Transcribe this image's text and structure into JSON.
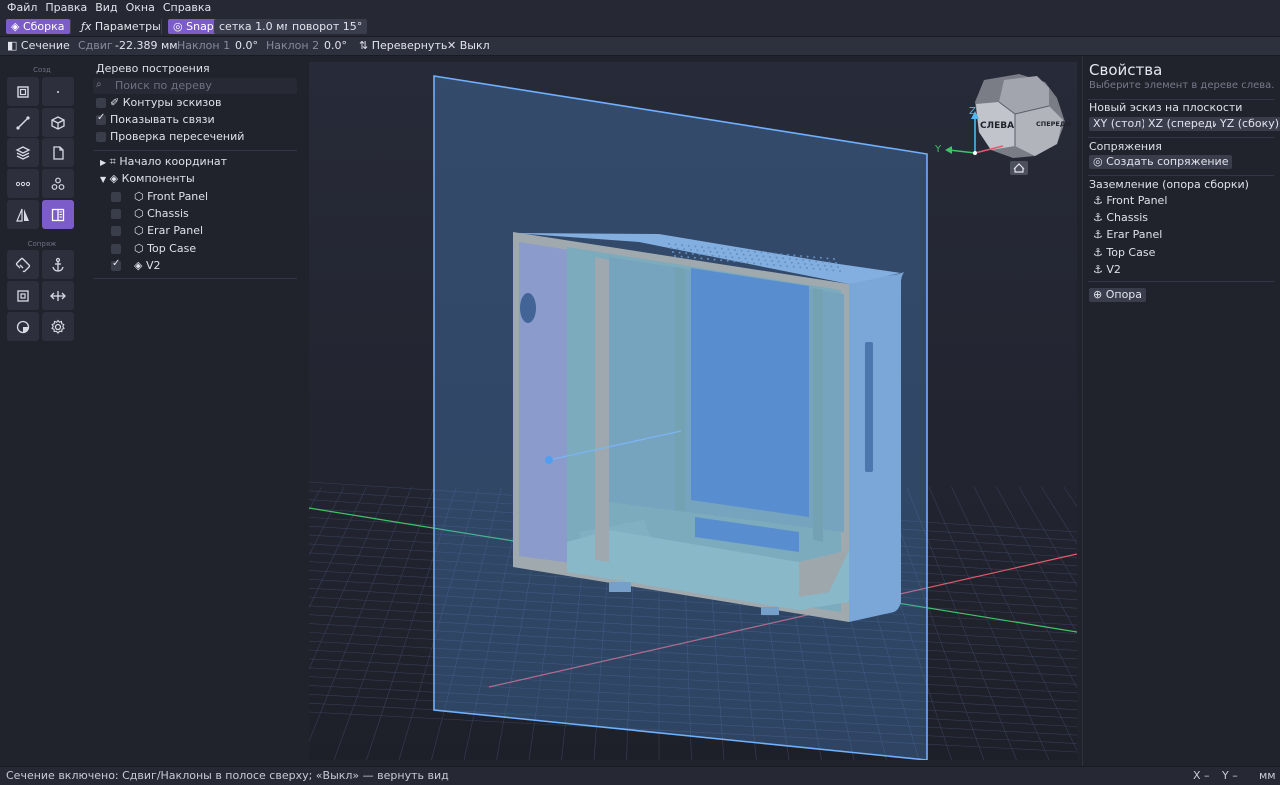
{
  "menu": [
    "Файл",
    "Правка",
    "Вид",
    "Окна",
    "Справка"
  ],
  "toolbar1": {
    "assembly": "Сборка",
    "params": "Параметры",
    "snap": "Snap",
    "grid": "сетка 1.0 мм",
    "rotate": "поворот 15°"
  },
  "toolbar2": {
    "section": "Сечение",
    "shift_label": "Сдвиг",
    "shift_value": "-22.389 мм",
    "tilt1_label": "Наклон 1",
    "tilt1_value": "0.0°",
    "tilt2_label": "Наклон 2",
    "tilt2_value": "0.0°",
    "flip": "Перевернуть",
    "off": "Выкл"
  },
  "tools": {
    "group_create": "Созд",
    "group_mates": "Сопряж"
  },
  "tree": {
    "title": "Дерево построения",
    "search_placeholder": "Поиск по дереву",
    "options": [
      {
        "label": "Контуры эскизов",
        "checked": false
      },
      {
        "label": "Показывать связи",
        "checked": true
      },
      {
        "label": "Проверка пересечений",
        "checked": false
      }
    ],
    "origin": "Начало координат",
    "components_label": "Компоненты",
    "components": [
      {
        "label": "Front Panel",
        "checked": false
      },
      {
        "label": "Chassis",
        "checked": false
      },
      {
        "label": "Erar Panel",
        "checked": false
      },
      {
        "label": "Top Case",
        "checked": false
      },
      {
        "label": "V2",
        "checked": true
      }
    ]
  },
  "viewcube": {
    "left": "СЛЕВА",
    "front": "СПЕРЕДИ",
    "axis_z": "Z",
    "axis_y": "Y"
  },
  "properties": {
    "title": "Свойства",
    "hint": "Выберите элемент в дереве слева.",
    "new_sketch_label": "Новый эскиз на плоскости",
    "planes": [
      "XY (стол)",
      "XZ (спереди)",
      "YZ (сбоку)"
    ],
    "mates_label": "Сопряжения",
    "create_mate": "Создать сопряжение",
    "ground_label": "Заземление (опора сборки)",
    "ground_items": [
      "Front Panel",
      "Chassis",
      "Erar Panel",
      "Top Case",
      "V2"
    ],
    "support": "Опора"
  },
  "status": {
    "message": "Сечение включено: Сдвиг/Наклоны в полосе сверху; «Выкл» — вернуть вид",
    "x": "X –",
    "y": "Y –",
    "unit": "мм"
  },
  "colors": {
    "accent": "#7b5cc8",
    "section_plane": "#4f8fd8",
    "axis_x": "#e05c6c",
    "axis_y": "#3fc46a",
    "axis_z": "#4fb8f0"
  }
}
